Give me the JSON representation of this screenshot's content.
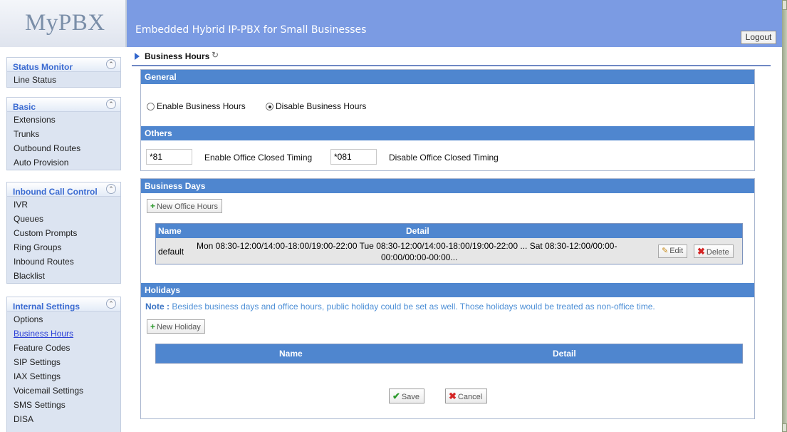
{
  "header": {
    "logo": "MyPBX",
    "tagline": "Embedded Hybrid IP-PBX for Small Businesses",
    "logout_label": "Logout"
  },
  "sidebar": {
    "groups": [
      {
        "title": "Status Monitor",
        "items": [
          "Line Status"
        ]
      },
      {
        "title": "Basic",
        "items": [
          "Extensions",
          "Trunks",
          "Outbound Routes",
          "Auto Provision"
        ]
      },
      {
        "title": "Inbound Call Control",
        "items": [
          "IVR",
          "Queues",
          "Custom Prompts",
          "Ring Groups",
          "Inbound Routes",
          "Blacklist"
        ]
      },
      {
        "title": "Internal Settings",
        "items": [
          "Options",
          "Business Hours",
          "Feature Codes",
          "SIP Settings",
          "IAX Settings",
          "Voicemail Settings",
          "SMS Settings",
          "DISA"
        ]
      }
    ],
    "active_item": "Business Hours"
  },
  "page": {
    "title": "Business Hours"
  },
  "general": {
    "heading": "General",
    "enable_label": "Enable Business Hours",
    "disable_label": "Disable Business Hours",
    "selected": "disable"
  },
  "others": {
    "heading": "Others",
    "enable_code": "*81",
    "enable_label": "Enable Office Closed Timing",
    "disable_code": "*081",
    "disable_label": "Disable Office Closed Timing"
  },
  "business_days": {
    "heading": "Business Days",
    "new_button": "New Office Hours",
    "columns": [
      "Name",
      "Detail"
    ],
    "rows": [
      {
        "name": "default",
        "detail_line1": "Mon 08:30-12:00/14:00-18:00/19:00-22:00  Tue 08:30-12:00/14:00-18:00/19:00-22:00 ... Sat 08:30-12:00/00:00-",
        "detail_line2": "00:00/00:00-00:00...",
        "edit_label": "Edit",
        "delete_label": "Delete"
      }
    ]
  },
  "holidays": {
    "heading": "Holidays",
    "note_prefix": "Note :",
    "note_text": "Besides business days and office hours, public holiday could be set as well. Those holidays would be treated as non-office time.",
    "new_button": "New Holiday",
    "columns": [
      "Name",
      "Detail"
    ]
  },
  "footer": {
    "save_label": "Save",
    "cancel_label": "Cancel"
  },
  "colors": {
    "header_bg": "#7b9be3",
    "section_head": "#4f86cf",
    "sidebar_group_bg": "#dce4f1",
    "sidebar_head_text": "#3a6ad1",
    "note_text": "#4d8fd6"
  }
}
